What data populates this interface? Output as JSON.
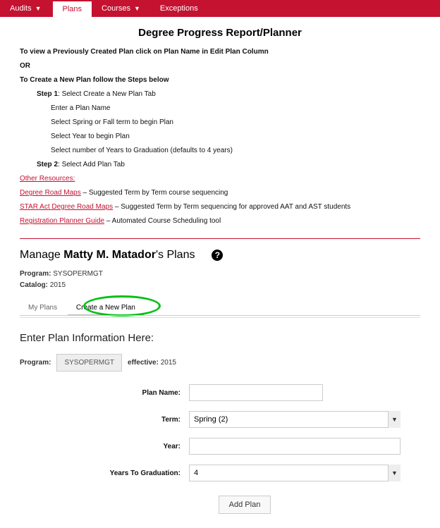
{
  "nav": {
    "audits": "Audits",
    "plans": "Plans",
    "courses": "Courses",
    "exceptions": "Exceptions"
  },
  "page_title": "Degree Progress Report/Planner",
  "instructions": {
    "view_prev": "To view a Previously Created Plan click on Plan Name in Edit Plan Column",
    "or": "OR",
    "create_new": "To Create a New Plan follow the Steps below",
    "step1_label": "Step 1",
    "step1_text": ": Select Create a New Plan Tab",
    "step1_a": "Enter a Plan Name",
    "step1_b": "Select Spring or Fall term to begin Plan",
    "step1_c": "Select Year to begin Plan",
    "step1_d": "Select number of Years to Graduation (defaults to 4 years)",
    "step2_label": "Step 2",
    "step2_text": ": Select Add Plan Tab",
    "other_resources": "Other Resources:",
    "link1": "Degree Road Maps",
    "link1_suffix": " – Suggested Term by Term course sequencing",
    "link2": "STAR Act Degree Road Maps",
    "link2_suffix": " – Suggested Term by Term sequencing for approved AAT and AST students",
    "link3": "Registration Planner Guide",
    "link3_suffix": " – Automated Course Scheduling tool"
  },
  "manage": {
    "prefix": "Manage ",
    "student_name": "Matty M. Matador",
    "suffix": "'s Plans",
    "help": "?"
  },
  "meta": {
    "program_label": "Program:",
    "program_value": " SYSOPERMGT",
    "catalog_label": "Catalog:",
    "catalog_value": " 2015"
  },
  "tabs": {
    "my_plans": "My Plans",
    "create": "Create a New Plan"
  },
  "section_head": "Enter Plan Information Here:",
  "prog_row": {
    "program_label": "Program:",
    "program_box": "SYSOPERMGT",
    "effective_label": "effective:",
    "effective_value": " 2015"
  },
  "form": {
    "plan_name_label": "Plan Name:",
    "term_label": "Term:",
    "term_value": "Spring (2)",
    "year_label": "Year:",
    "years_grad_label": "Years To Graduation:",
    "years_grad_value": "4",
    "add_plan": "Add Plan"
  }
}
